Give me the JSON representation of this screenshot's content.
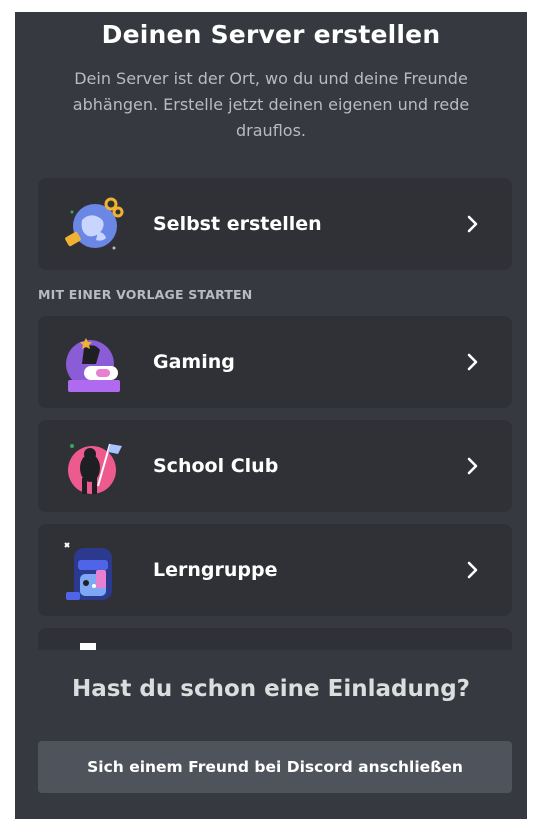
{
  "header": {
    "title": "Deinen Server erstellen",
    "subtitle": "Dein Server ist der Ort, wo du und deine Freunde abhängen. Erstelle jetzt deinen eigenen und rede drauflos."
  },
  "create_own": {
    "label": "Selbst erstellen",
    "icon": "globe-with-tools-icon"
  },
  "templates": {
    "section_label": "MIT EINER VORLAGE STARTEN",
    "items": [
      {
        "label": "Gaming",
        "icon": "gaming-controller-icon"
      },
      {
        "label": "School Club",
        "icon": "school-flag-icon"
      },
      {
        "label": "Lerngruppe",
        "icon": "backpack-icon"
      }
    ]
  },
  "invite": {
    "question": "Hast du schon eine Einladung?",
    "button_label": "Sich einem Freund bei Discord anschließen"
  },
  "colors": {
    "background": "#36393f",
    "card": "#2f3136",
    "button": "#4f545c",
    "text_primary": "#ffffff",
    "text_muted": "#b9bbbe"
  }
}
